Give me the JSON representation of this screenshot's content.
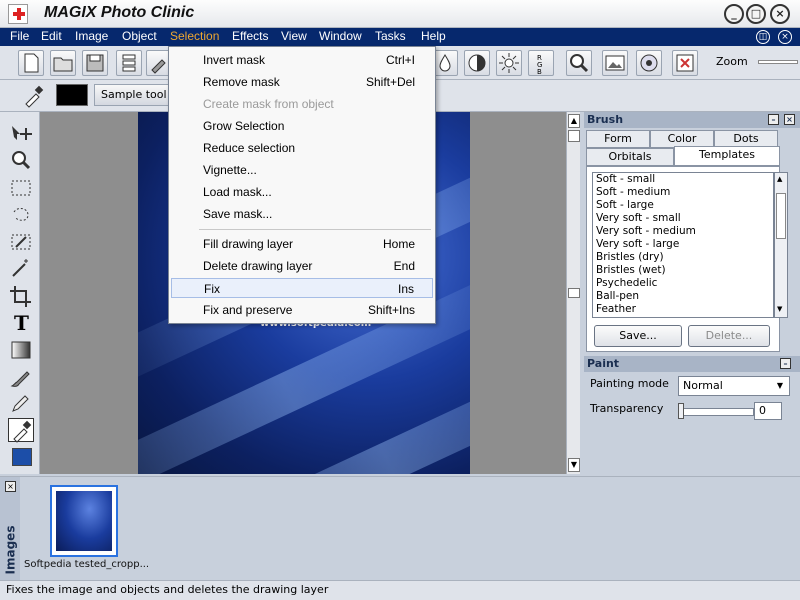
{
  "window": {
    "title": "MAGIX Photo Clinic",
    "buttons": [
      "_",
      "□",
      "×"
    ]
  },
  "menu": {
    "items": [
      "File",
      "Edit",
      "Image",
      "Object",
      "Selection",
      "Effects",
      "View",
      "Window",
      "Tasks",
      "Help"
    ],
    "active": "Selection"
  },
  "toolbar": {
    "zoom_label": "Zoom"
  },
  "toolbar2": {
    "sample_label": "Sample tool"
  },
  "selection_menu": {
    "items": [
      {
        "label": "Invert mask",
        "key": "Ctrl+I"
      },
      {
        "label": "Remove mask",
        "key": "Shift+Del"
      },
      {
        "label": "Create mask from object",
        "key": "",
        "disabled": true
      },
      {
        "label": "Grow Selection",
        "key": ""
      },
      {
        "label": "Reduce selection",
        "key": ""
      },
      {
        "label": "Vignette...",
        "key": ""
      },
      {
        "label": "Load mask...",
        "key": ""
      },
      {
        "label": "Save mask...",
        "key": ""
      },
      {
        "label": "Fill drawing layer",
        "key": "Home"
      },
      {
        "label": "Delete drawing layer",
        "key": "End"
      },
      {
        "label": "Fix",
        "key": "Ins",
        "highlighted": true
      },
      {
        "label": "Fix and preserve",
        "key": "Shift+Ins"
      }
    ]
  },
  "image": {
    "caption": "www.softpedia.com"
  },
  "brush_panel": {
    "title": "Brush",
    "tabs_row1": [
      "Form",
      "Color",
      "Dots"
    ],
    "tabs_row2": [
      "Orbitals",
      "Templates"
    ],
    "active_tab": "Templates",
    "templates": [
      "Soft - small",
      "Soft - medium",
      "Soft - large",
      "Very soft - small",
      "Very soft - medium",
      "Very soft - large",
      "Bristles (dry)",
      "Bristles (wet)",
      "Psychedelic",
      "Ball-pen",
      "Feather"
    ],
    "save_label": "Save...",
    "delete_label": "Delete..."
  },
  "paint_panel": {
    "title": "Paint",
    "painting_mode_label": "Painting mode",
    "painting_mode_value": "Normal",
    "transparency_label": "Transparency",
    "transparency_value": "0"
  },
  "images_panel": {
    "title": "Images",
    "thumbnail_label": "Softpedia tested_cropp..."
  },
  "status": {
    "text": "Fixes the image and objects and deletes the drawing layer"
  },
  "colors": {
    "menubar": "#06286d",
    "active_menu": "#f0a830",
    "thumb_border": "#2a72e0"
  }
}
